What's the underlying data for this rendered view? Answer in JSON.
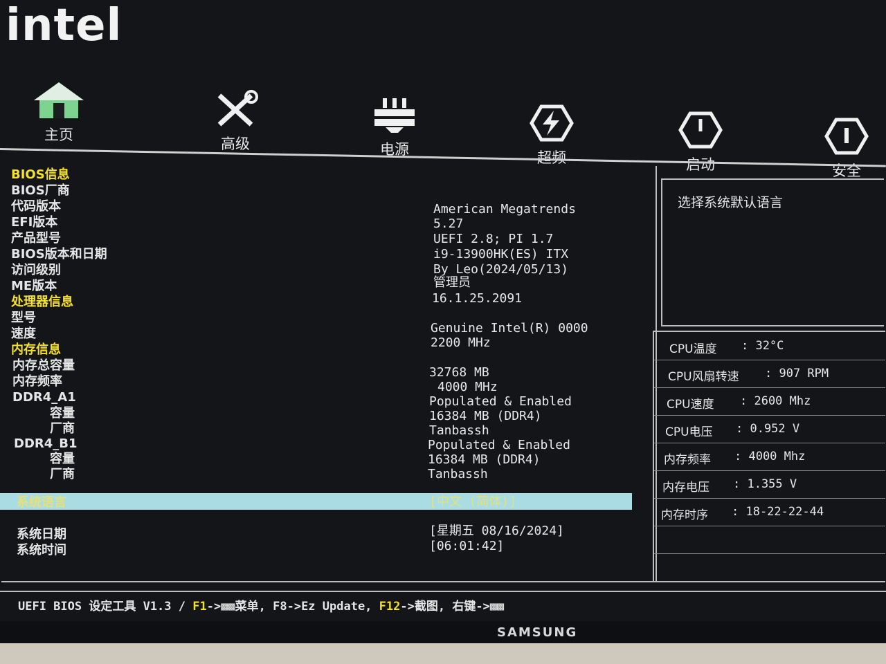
{
  "brand_logo": "intel",
  "nav": {
    "items": [
      {
        "label": "主页",
        "icon": "home-icon"
      },
      {
        "label": "高级",
        "icon": "tools-icon"
      },
      {
        "label": "电源",
        "icon": "power-plug-icon"
      },
      {
        "label": "超频",
        "icon": "lightning-icon"
      },
      {
        "label": "启动",
        "icon": "power-button-icon"
      },
      {
        "label": "安全",
        "icon": "shield-icon"
      }
    ]
  },
  "main": {
    "bios_info_header": "BIOS信息",
    "bios_vendor_label": "BIOS厂商",
    "bios_vendor_value": "American Megatrends",
    "code_version_label": "代码版本",
    "code_version_value": "5.27",
    "efi_version_label": "EFI版本",
    "efi_version_value": "UEFI 2.8; PI 1.7",
    "product_model_label": "产品型号",
    "product_model_value": "i9-13900HK(ES) ITX",
    "bios_version_date_label": "BIOS版本和日期",
    "bios_version_date_value": "By Leo(2024/05/13)",
    "access_level_label": "访问级别",
    "access_level_value": "管理员",
    "me_version_label": "ME版本",
    "me_version_value": "16.1.25.2091",
    "cpu_info_header": "处理器信息",
    "cpu_model_label": "型号",
    "cpu_model_value": "Genuine Intel(R) 0000",
    "cpu_speed_label": "速度",
    "cpu_speed_value": "2200 MHz",
    "memory_info_header": "内存信息",
    "memory_total_label": "内存总容量",
    "memory_total_value": "32768 MB",
    "memory_freq_label": "内存频率",
    "memory_freq_value": "4000 MHz",
    "ddr4_a1_label": "DDR4_A1",
    "ddr4_a1_status": "Populated & Enabled",
    "ddr4_a1_size_label": "容量",
    "ddr4_a1_size_value": "16384 MB (DDR4)",
    "ddr4_a1_vendor_label": "厂商",
    "ddr4_a1_vendor_value": "Tanbassh",
    "ddr4_b1_label": "DDR4_B1",
    "ddr4_b1_status": "Populated & Enabled",
    "ddr4_b1_size_label": "容量",
    "ddr4_b1_size_value": "16384 MB (DDR4)",
    "ddr4_b1_vendor_label": "厂商",
    "ddr4_b1_vendor_value": "Tanbassh",
    "system_language_label": "系统语言",
    "system_language_value": "[中文 (简体)]",
    "system_date_label": "系统日期",
    "system_date_value": "[星期五 08/16/2024]",
    "system_time_label": "系统时间",
    "system_time_value": "[06:01:42]"
  },
  "help": {
    "text": "选择系统默认语言"
  },
  "status": {
    "rows": [
      {
        "label": "CPU温度",
        "value": ": 32°C"
      },
      {
        "label": "CPU风扇转速",
        "value": ": 907 RPM"
      },
      {
        "label": "CPU速度",
        "value": ": 2600 Mhz"
      },
      {
        "label": "CPU电压",
        "value": ": 0.952 V"
      },
      {
        "label": "内存频率",
        "value": ": 4000 Mhz"
      },
      {
        "label": "内存电压",
        "value": ": 1.355 V"
      },
      {
        "label": "内存时序",
        "value": ": 18-22-22-44"
      }
    ]
  },
  "footer": {
    "prefix": "UEFI BIOS 设定工具 V1.3 / ",
    "f1_key": "F1",
    "f1_text": "->▩▩菜单, F8->Ez Update, ",
    "f12_key": "F12",
    "f12_text": "->截图, 右键->▩▩"
  },
  "monitor_brand": "SAMSUNG",
  "colors": {
    "header_yellow": "#f5e02a",
    "highlight_bar": "#a9dde3",
    "background": "#141519"
  }
}
